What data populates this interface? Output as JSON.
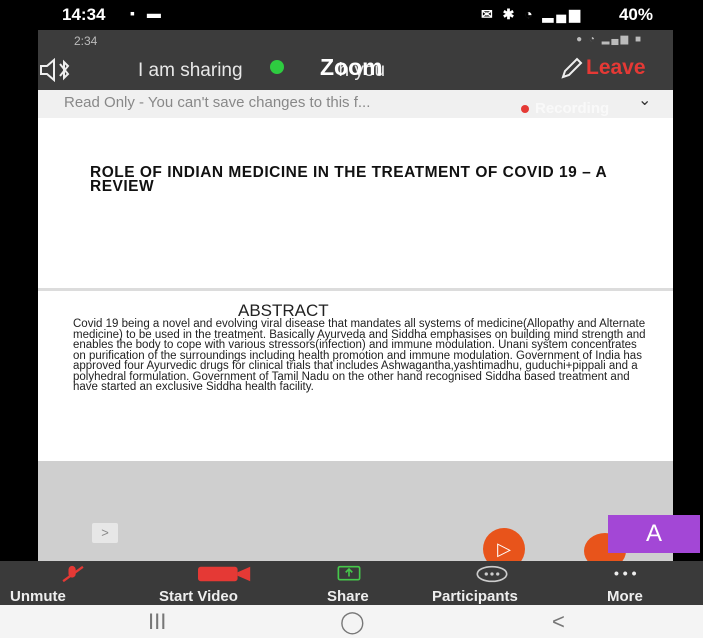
{
  "status_bar": {
    "time": "14:34",
    "left_icons": "▪ ▬",
    "right_icons": "✉ ✱ ◔ ▂▄▆",
    "battery": "40%"
  },
  "zoom_header": {
    "inner_time": "2:34",
    "inner_icons": "● ◔ ▂▄▆ ■",
    "sharing_text": "I am sharing",
    "sharing_text_tail": "h you",
    "app_label": "Zoom",
    "leave_label": "Leave",
    "recording_label": "Recording"
  },
  "document_bar": {
    "readonly_text": "Read Only - You can't save changes to this f..."
  },
  "document": {
    "title": "ROLE OF INDIAN MEDICINE IN THE TREATMENT OF COVID 19 – A REVIEW",
    "abstract_heading": "ABSTRACT",
    "abstract_body": "Covid 19 being a novel and evolving viral disease that mandates all systems of medicine(Allopathy and Alternate medicine) to be used in the treatment. Basically Ayurveda and Siddha emphasises on building mind strength and enables the body to cope with various stressors(infection) and immune modulation. Unani system concentrates on purification of the surroundings including health promotion and immune modulation. Government of India has approved four Ayurvedic drugs for clinical trials that includes Ashwagantha,yashtimadhu, guduchi+pippali and a polyhedral formulation. Government of Tamil Nadu on the other hand recognised Siddha based treatment and have started an exclusive Siddha health facility."
  },
  "overlay": {
    "collapse_glyph": ">",
    "fab_glyph": "▷",
    "annotate_letter": "A"
  },
  "toolbar": {
    "unmute": "Unmute",
    "start_video": "Start Video",
    "share": "Share",
    "participants": "Participants",
    "more": "More",
    "more_glyph": "• • •"
  },
  "android_nav": {
    "recents": "III",
    "home": "◯",
    "back": "<"
  },
  "colors": {
    "leave": "#e53935",
    "zoom_header": "#3c3c3c",
    "toolbar": "#3a3a3a",
    "fab": "#e8541b",
    "annotate": "#a347d6",
    "green_dot": "#2ecc40"
  }
}
